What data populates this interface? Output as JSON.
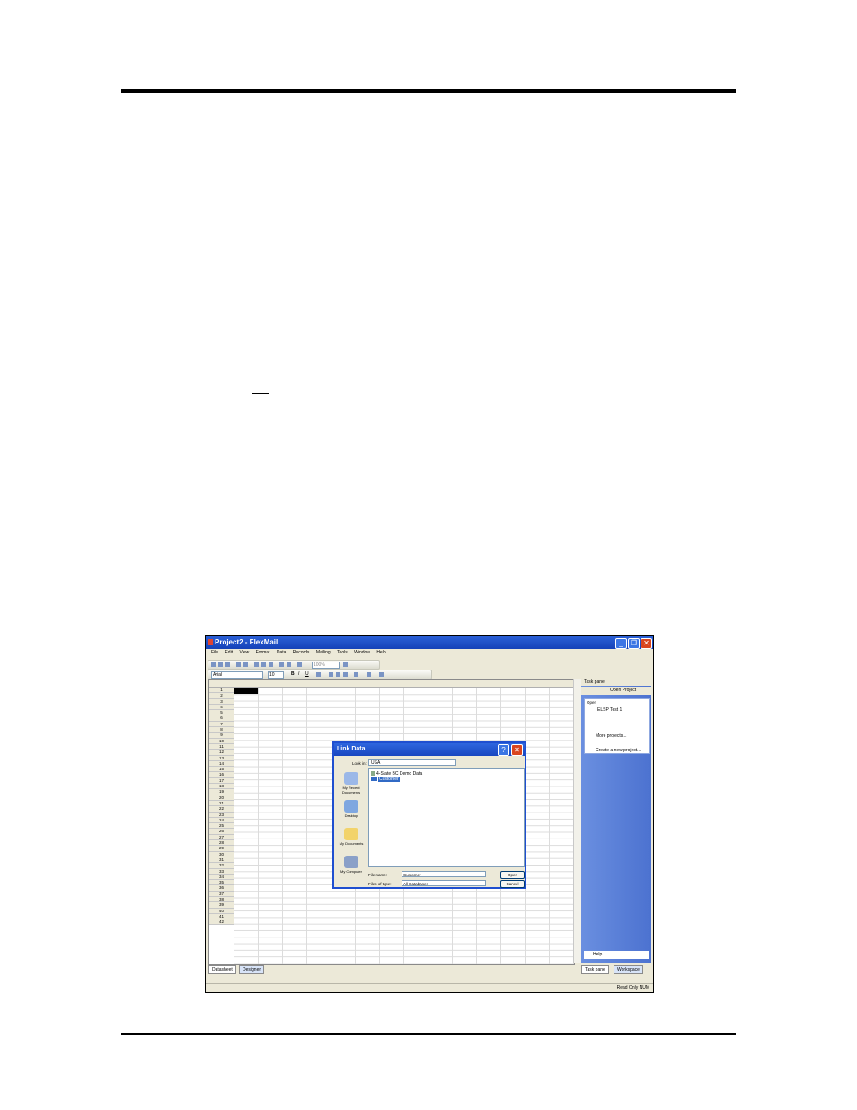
{
  "window": {
    "title": "Project2 - FlexMail",
    "minimize_glyph": "_",
    "restore_glyph": "❐",
    "close_glyph": "✕"
  },
  "menu": [
    "File",
    "Edit",
    "View",
    "Format",
    "Data",
    "Records",
    "Mailing",
    "Tools",
    "Window",
    "Help"
  ],
  "format_toolbar": {
    "font": "Arial",
    "size": "10",
    "bold": "B",
    "italic": "I",
    "underline": "U",
    "zoom": "100%"
  },
  "grid": {
    "rows": [
      "1",
      "2",
      "3",
      "4",
      "5",
      "6",
      "7",
      "8",
      "9",
      "10",
      "11",
      "12",
      "13",
      "14",
      "15",
      "16",
      "17",
      "18",
      "19",
      "20",
      "21",
      "22",
      "23",
      "24",
      "25",
      "26",
      "27",
      "28",
      "29",
      "30",
      "31",
      "32",
      "33",
      "34",
      "35",
      "36",
      "37",
      "38",
      "39",
      "40",
      "41",
      "42"
    ]
  },
  "tabs": {
    "datasheet": "Datasheet",
    "designer": "Designer"
  },
  "task_pane": {
    "title": "Task pane",
    "open_project": "Open Project",
    "open_header": "Open",
    "recent_item": "ELSP Test 1",
    "more_projects": "More projects...",
    "create_new": "Create a new project...",
    "help": "Help...",
    "tab_taskpane": "Task pane",
    "tab_workspace": "Workspace"
  },
  "dialog": {
    "title": "Link Data",
    "help_glyph": "?",
    "close_glyph": "✕",
    "look_in_label": "Look in:",
    "look_in_value": "USA",
    "places": [
      "My Recent Documents",
      "Desktop",
      "My Documents",
      "My Computer"
    ],
    "files": [
      "4-State BC Demo Data",
      "Customer"
    ],
    "file_name_label": "File name:",
    "file_name_value": "Customer",
    "files_of_type_label": "Files of type:",
    "files_of_type_value": "All Databases",
    "open_button": "Open",
    "cancel_button": "Cancel"
  },
  "status": {
    "read_only": "Read Only",
    "mode": "NUM"
  }
}
